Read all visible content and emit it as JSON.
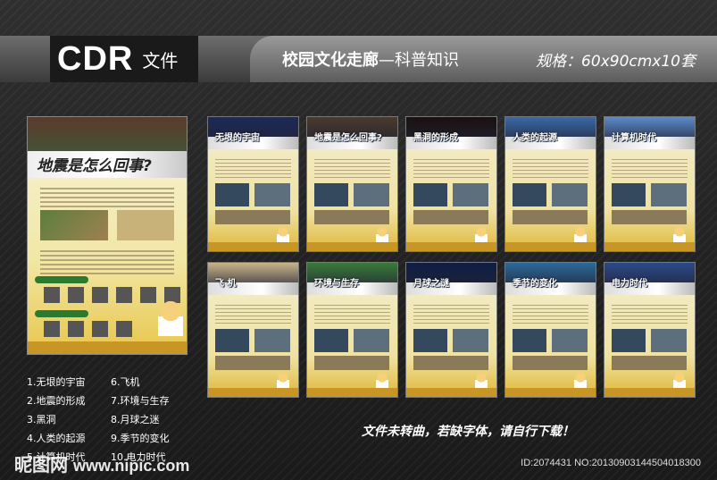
{
  "header": {
    "badge_main": "CDR",
    "badge_sub": "文件",
    "title_bold": "校园文化走廊",
    "title_rest": "—科普知识",
    "spec": "规格：60x90cmx10套"
  },
  "featured_poster": {
    "title": "地震是怎么回事?"
  },
  "posters": [
    {
      "title": "无垠的宇宙",
      "header_color": "#1b2a5a"
    },
    {
      "title": "地震是怎么回事?",
      "header_color": "#4a3a2a"
    },
    {
      "title": "黑洞的形成",
      "header_color": "#1a1010"
    },
    {
      "title": "人类的起源",
      "header_color": "#3a6aa8"
    },
    {
      "title": "计算机时代",
      "header_color": "#5a8acb"
    },
    {
      "title": "飞 机",
      "header_color": "#c9b48a"
    },
    {
      "title": "环境与生存",
      "header_color": "#3a7a3a"
    },
    {
      "title": "月球之谜",
      "header_color": "#0e1e46"
    },
    {
      "title": "季节的变化",
      "header_color": "#2a6a9a"
    },
    {
      "title": "电力时代",
      "header_color": "#2a4a8a"
    }
  ],
  "list": {
    "left": [
      "1.无垠的宇宙",
      "2.地震的形成",
      "3.黑洞",
      "4.人类的起源",
      "5.计算机时代"
    ],
    "right": [
      "6.飞机",
      "7.环境与生存",
      "8.月球之迷",
      "9.季节的变化",
      "10.电力时代"
    ]
  },
  "note": "文件未转曲，若缺字体，请自行下载！",
  "watermark": {
    "brand": "昵图网",
    "url": "www.nipic.com"
  },
  "image_id": "ID:2074431 NO:20130903144504018300"
}
